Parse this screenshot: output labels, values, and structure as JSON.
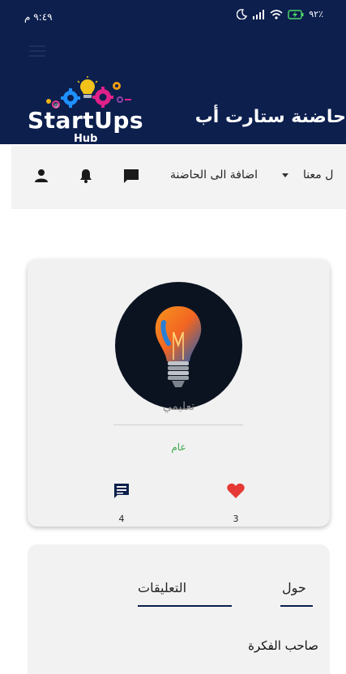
{
  "status_bar": {
    "time": "٩:٤٩ م",
    "battery": "٩٢٪"
  },
  "header": {
    "logo_main": "StartUps",
    "logo_sub": "Hub",
    "site_title": "حاضنة ستارت أب"
  },
  "navbar": {
    "item_about": "ل معنا",
    "item_add": "اضافة الى الحاضنة",
    "icons": [
      "message-icon",
      "bell-icon",
      "user-icon"
    ]
  },
  "idea_card": {
    "category": "تعليمي",
    "visibility": "عام",
    "comments_count": "4",
    "likes_count": "3",
    "colors": {
      "visibility": "#3ca84a",
      "like": "#e53935",
      "comment": "#0c1f4d"
    }
  },
  "tabs": {
    "about": "حول",
    "comments": "التعليقات",
    "section_title": "صاحب الفكرة"
  },
  "colors": {
    "header_bg": "#0c1f4d",
    "navbar_bg": "#f3f3f3"
  }
}
